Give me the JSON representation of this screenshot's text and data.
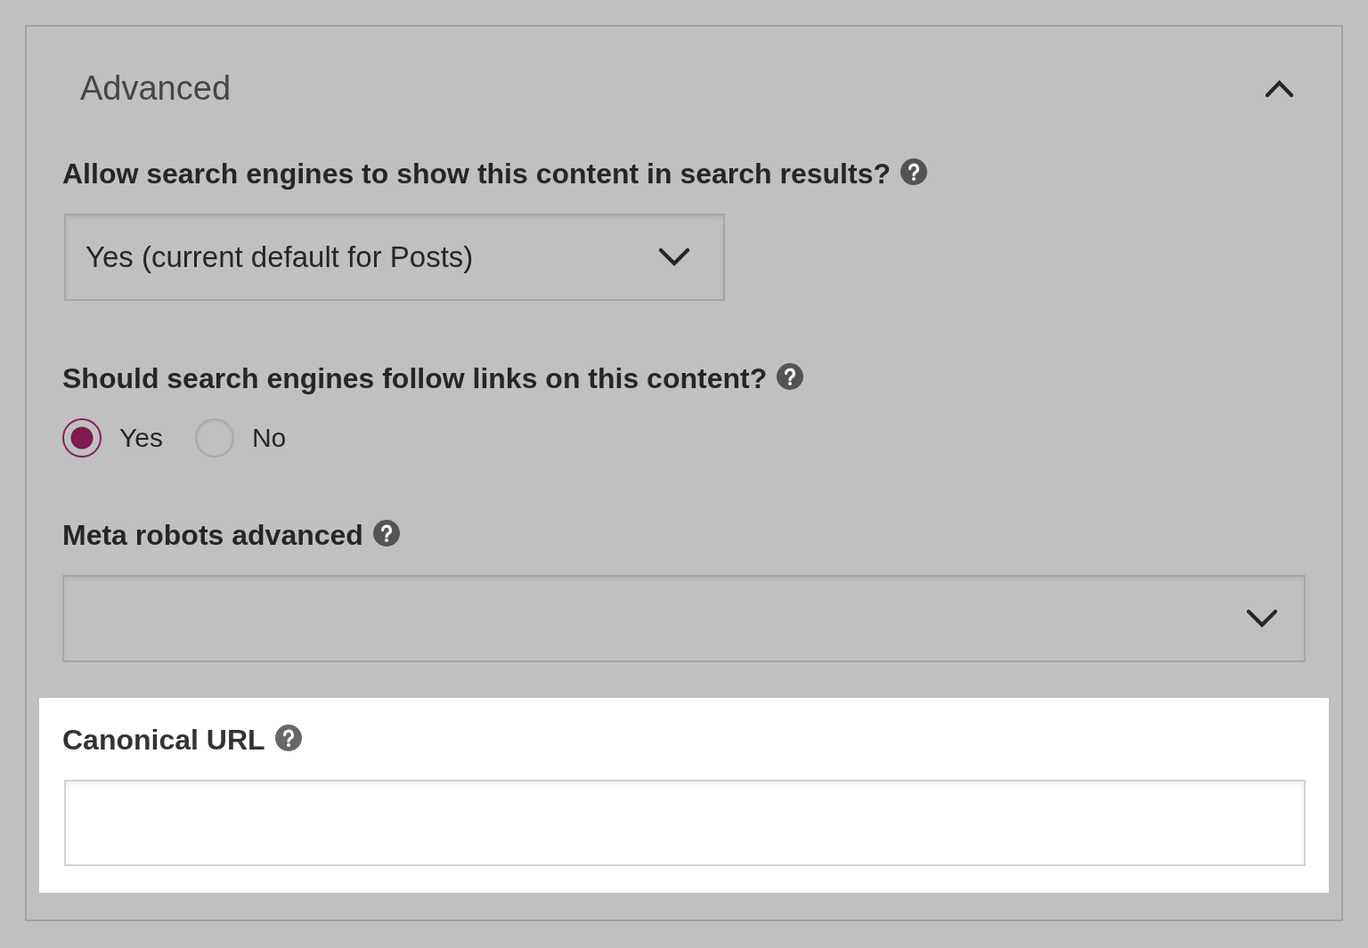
{
  "section": {
    "title": "Advanced",
    "expanded": true,
    "fields": [
      {
        "kind": "select",
        "label": "Allow search engines to show this content in search results?",
        "value": "Yes (current default for Posts)",
        "highlighted": false
      },
      {
        "kind": "radio",
        "label": "Should search engines follow links on this content?",
        "options": [
          {
            "label": "Yes",
            "selected": true
          },
          {
            "label": "No",
            "selected": false
          }
        ],
        "highlighted": false
      },
      {
        "kind": "select",
        "label": "Meta robots advanced",
        "highlighted": false
      },
      {
        "kind": "text",
        "label": "Canonical URL",
        "highlighted": true
      }
    ]
  }
}
